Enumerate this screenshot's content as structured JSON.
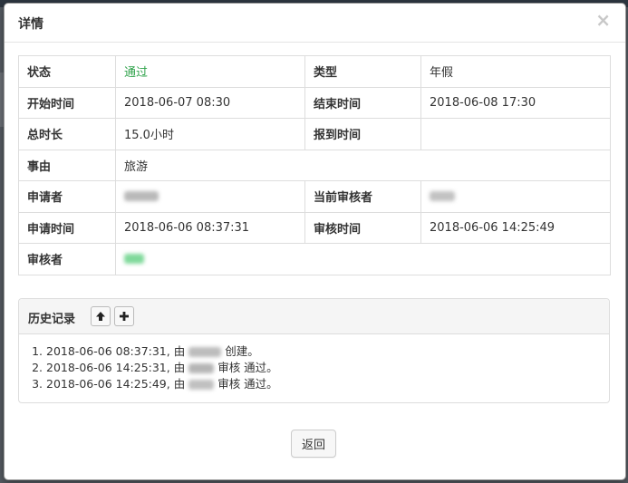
{
  "modal": {
    "title": "详情",
    "close_glyph": "×"
  },
  "details": {
    "status_label": "状态",
    "status_value": "通过",
    "type_label": "类型",
    "type_value": "年假",
    "start_label": "开始时间",
    "start_value": "2018-06-07 08:30",
    "end_label": "结束时间",
    "end_value": "2018-06-08 17:30",
    "duration_label": "总时长",
    "duration_value": "15.0小时",
    "checkin_label": "报到时间",
    "checkin_value": "",
    "reason_label": "事由",
    "reason_value": "旅游",
    "applicant_label": "申请者",
    "current_reviewer_label": "当前审核者",
    "apply_time_label": "申请时间",
    "apply_time_value": "2018-06-06 08:37:31",
    "review_time_label": "审核时间",
    "review_time_value": "2018-06-06 14:25:49",
    "reviewer_label": "审核者"
  },
  "colors": {
    "status_ok": "#2ea24a"
  },
  "history": {
    "title": "历史记录",
    "collapse_icon": "arrow-up-icon",
    "add_icon": "plus-icon",
    "entries": [
      {
        "time": "2018-06-06 08:37:31",
        "prefix": ", 由",
        "suffix": "创建。"
      },
      {
        "time": "2018-06-06 14:25:31",
        "prefix": ", 由",
        "suffix": "审核 通过。"
      },
      {
        "time": "2018-06-06 14:25:49",
        "prefix": ", 由",
        "suffix": "审核 通过。"
      }
    ]
  },
  "footer": {
    "back_label": "返回"
  }
}
